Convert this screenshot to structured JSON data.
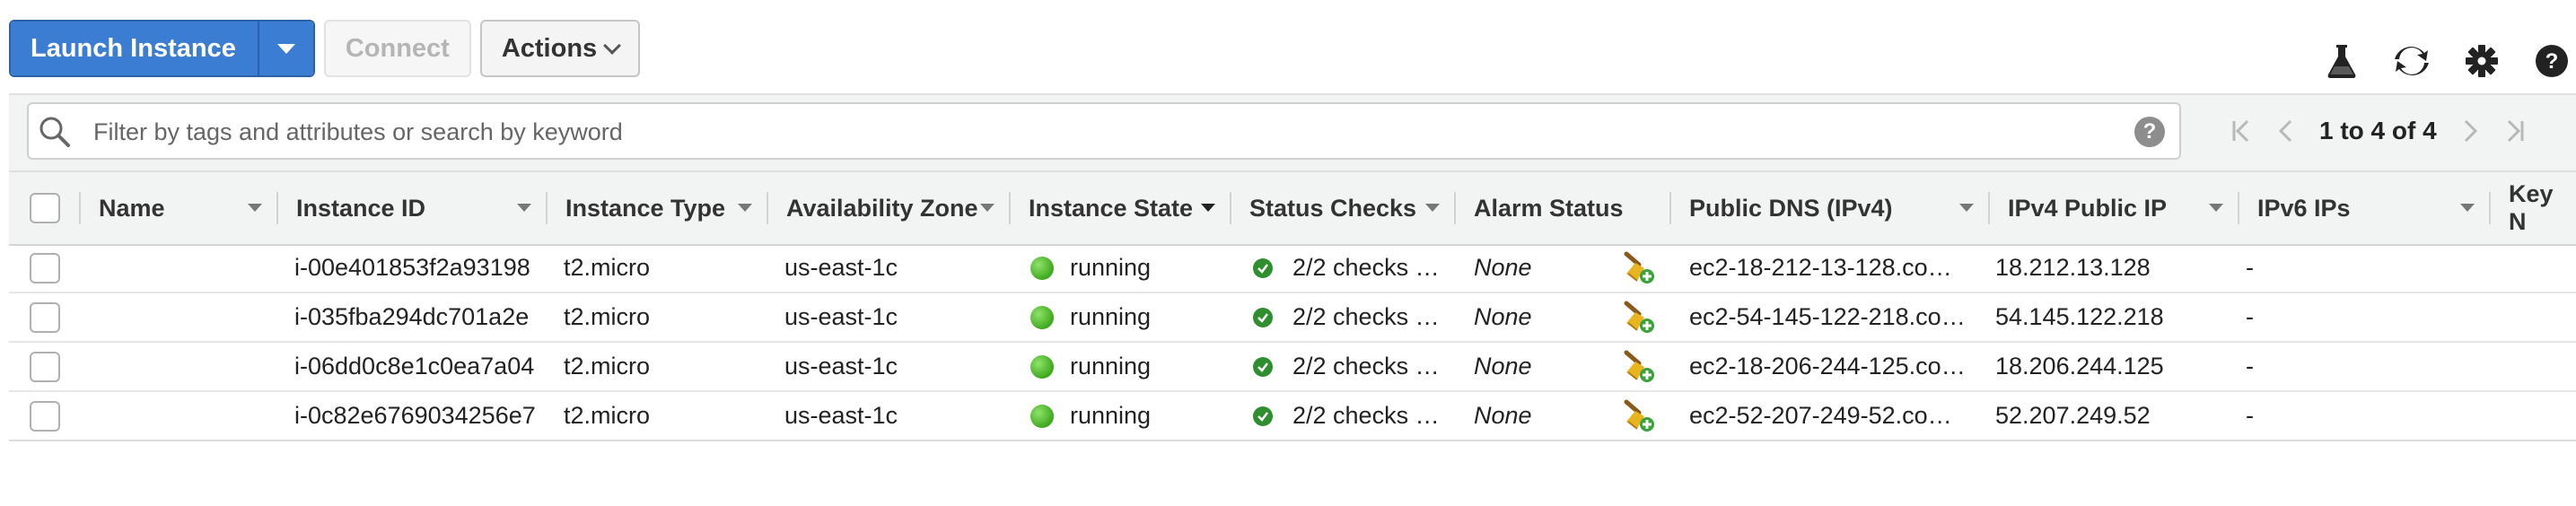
{
  "toolbar": {
    "launch_label": "Launch Instance",
    "connect_label": "Connect",
    "actions_label": "Actions"
  },
  "top_icons": [
    "flask-icon",
    "refresh-icon",
    "gear-icon",
    "help-icon"
  ],
  "filter": {
    "placeholder": "Filter by tags and attributes or search by keyword",
    "help": "?"
  },
  "pagination": {
    "text": "1 to 4 of 4"
  },
  "columns": [
    "Name",
    "Instance ID",
    "Instance Type",
    "Availability Zone",
    "Instance State",
    "Status Checks",
    "Alarm Status",
    "Public DNS (IPv4)",
    "IPv4 Public IP",
    "IPv6 IPs",
    "Key N"
  ],
  "rows": [
    {
      "name": "",
      "instance_id": "i-00e401853f2a93198",
      "type": "t2.micro",
      "az": "us-east-1c",
      "state": "running",
      "checks": "2/2 checks …",
      "alarm": "None",
      "dns": "ec2-18-212-13-128.co…",
      "ipv4": "18.212.13.128",
      "ipv6": "-"
    },
    {
      "name": "",
      "instance_id": "i-035fba294dc701a2e",
      "type": "t2.micro",
      "az": "us-east-1c",
      "state": "running",
      "checks": "2/2 checks …",
      "alarm": "None",
      "dns": "ec2-54-145-122-218.co…",
      "ipv4": "54.145.122.218",
      "ipv6": "-"
    },
    {
      "name": "",
      "instance_id": "i-06dd0c8e1c0ea7a04",
      "type": "t2.micro",
      "az": "us-east-1c",
      "state": "running",
      "checks": "2/2 checks …",
      "alarm": "None",
      "dns": "ec2-18-206-244-125.co…",
      "ipv4": "18.206.244.125",
      "ipv6": "-"
    },
    {
      "name": "",
      "instance_id": "i-0c82e6769034256e7",
      "type": "t2.micro",
      "az": "us-east-1c",
      "state": "running",
      "checks": "2/2 checks …",
      "alarm": "None",
      "dns": "ec2-52-207-249-52.co…",
      "ipv4": "52.207.249.52",
      "ipv6": "-"
    }
  ],
  "colors": {
    "primary": "#3c7dd4",
    "running": "#3fa81e",
    "check_ok": "#2f8f2f"
  }
}
